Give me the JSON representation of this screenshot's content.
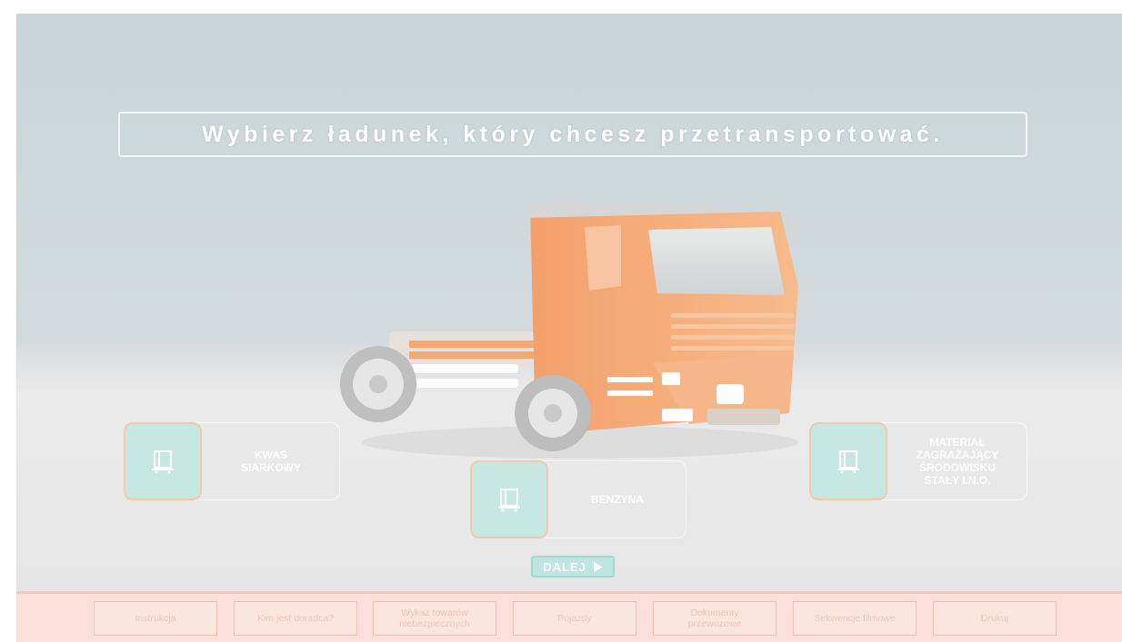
{
  "header": {
    "title": "Wybierz ładunek, który chcesz przetransportować."
  },
  "cargo_options": [
    {
      "label": "KWAS\nSIARKOWY",
      "icon": "pallet-icon"
    },
    {
      "label": "BENZYNA",
      "icon": "pallet-icon"
    },
    {
      "label": "MATERIAŁ\nZAGRAŻAJĄCY\nŚRODOWISKU\nSTAŁY I.N.O.",
      "icon": "pallet-icon"
    }
  ],
  "next_button": {
    "label": "DALEJ",
    "icon": "play-icon"
  },
  "bottom_nav": [
    {
      "label": "Instrukcja"
    },
    {
      "label": "Kim jest doradca?"
    },
    {
      "label": "Wykaz towarów\nniebezpiecznych"
    },
    {
      "label": "Pojazdy"
    },
    {
      "label": "Dokumenty\nprzewozowe"
    },
    {
      "label": "Sekwencje filmowe"
    },
    {
      "label": "Drukuj"
    }
  ],
  "colors": {
    "truck": "#f4a06a",
    "icon_tile": "#c7e7e3",
    "bottom_bar": "#fae0d8",
    "accent_border": "#f3c8ae"
  }
}
